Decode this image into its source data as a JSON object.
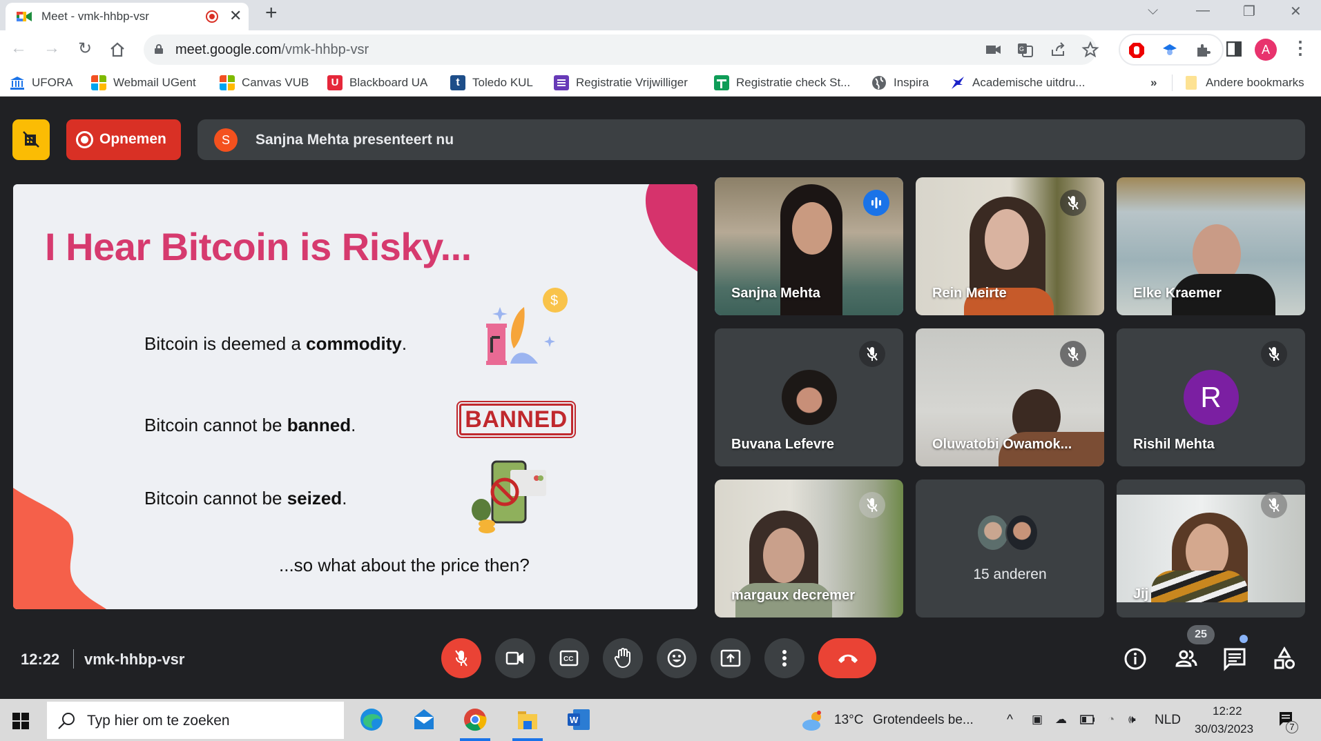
{
  "browser": {
    "tab_title": "Meet - vmk-hhbp-vsr",
    "tab_recording": true,
    "new_tab_label": "+",
    "url_host": "meet.google.com",
    "url_path": "/vmk-hhbp-vsr",
    "profile_initial": "A",
    "profile_color": "#e8336d",
    "bookmarks": [
      {
        "label": "UFORA",
        "icon": "ufora-icon"
      },
      {
        "label": "Webmail UGent",
        "icon": "microsoft-icon"
      },
      {
        "label": "Canvas VUB",
        "icon": "microsoft-icon"
      },
      {
        "label": "Blackboard UA",
        "icon": "blackboard-icon"
      },
      {
        "label": "Toledo KUL",
        "icon": "toledo-icon"
      },
      {
        "label": "Registratie Vrijwilliger",
        "icon": "google-forms-icon"
      },
      {
        "label": "Registratie check St...",
        "icon": "google-sheets-icon"
      },
      {
        "label": "Inspira",
        "icon": "globe-icon"
      },
      {
        "label": "Academische uitdru...",
        "icon": "academic-icon"
      }
    ],
    "overflow_label": "»",
    "other_bookmarks_label": "Andere bookmarks"
  },
  "meet": {
    "record_label": "Opnemen",
    "presenter_initial": "S",
    "presenting_text": "Sanjna Mehta presenteert nu",
    "slide": {
      "title": "I Hear Bitcoin is Risky...",
      "bullets": [
        {
          "prefix": "Bitcoin is deemed a ",
          "bold": "commodity",
          "suffix": "."
        },
        {
          "prefix": "Bitcoin cannot be ",
          "bold": "banned",
          "suffix": "."
        },
        {
          "prefix": "Bitcoin cannot be ",
          "bold": "seized",
          "suffix": "."
        }
      ],
      "banned_stamp": "BANNED",
      "closing": "...so what about the price then?"
    },
    "participants": [
      {
        "name": "Sanjna Mehta",
        "speaking": true,
        "muted": false,
        "video": true
      },
      {
        "name": "Rein Meirte",
        "speaking": false,
        "muted": true,
        "video": true
      },
      {
        "name": "Elke Kraemer",
        "speaking": false,
        "muted": false,
        "video": true
      },
      {
        "name": "Buvana Lefevre",
        "speaking": false,
        "muted": true,
        "video": false,
        "avatar": "photo"
      },
      {
        "name": "Oluwatobi Owamok...",
        "speaking": false,
        "muted": true,
        "video": true
      },
      {
        "name": "Rishil Mehta",
        "speaking": false,
        "muted": true,
        "video": false,
        "avatar_initial": "R",
        "avatar_color": "#7b1fa2"
      },
      {
        "name": "margaux decremer",
        "speaking": false,
        "muted": true,
        "video": true
      },
      {
        "name": "15 anderen",
        "others_tile": true
      },
      {
        "name": "Jij",
        "speaking": false,
        "muted": true,
        "video": true,
        "self": true
      }
    ],
    "clock": "12:22",
    "meeting_code": "vmk-hhbp-vsr",
    "participant_count": "25",
    "chat_unread": true
  },
  "taskbar": {
    "search_placeholder": "Typ hier om te zoeken",
    "weather_temp": "13°C",
    "weather_text": "Grotendeels be...",
    "language": "NLD",
    "time": "12:22",
    "date": "30/03/2023",
    "notifications": "7"
  }
}
